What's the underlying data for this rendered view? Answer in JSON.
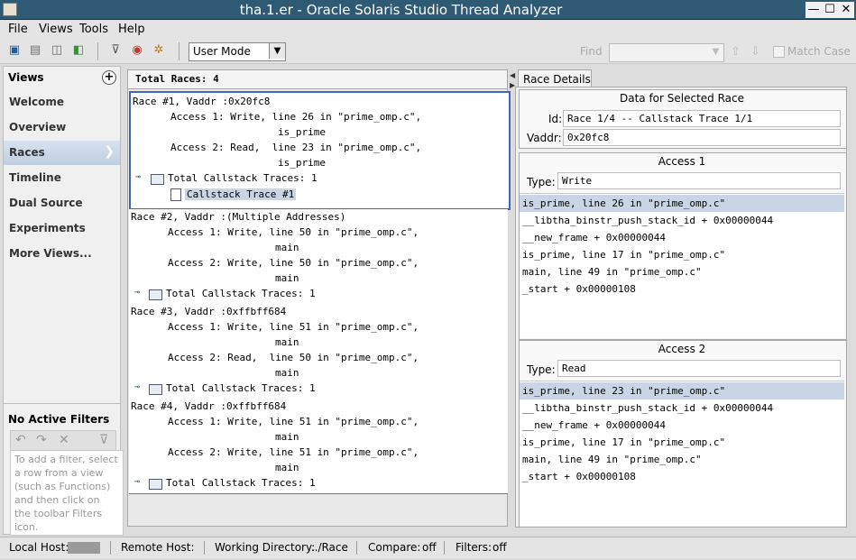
{
  "window": {
    "title": "tha.1.er  -  Oracle Solaris Studio Thread Analyzer",
    "min": "—",
    "max": "☐",
    "close": "✕"
  },
  "menu": [
    "File",
    "Views",
    "Tools",
    "Help"
  ],
  "toolbar": {
    "mode": "User Mode",
    "find_label": "Find",
    "match_case": "Match Case"
  },
  "views": {
    "title": "Views",
    "add": "+",
    "items": [
      "Welcome",
      "Overview",
      "Races",
      "Timeline",
      "Dual Source",
      "Experiments",
      "More Views..."
    ],
    "selected_chevron": "❯"
  },
  "filters": {
    "title": "No Active Filters",
    "help": "To add a filter, select a row from a view (such as Functions) and then click on the toolbar Filters icon."
  },
  "races": {
    "header": "Total Races: 4",
    "list": [
      {
        "title": "Race #1, Vaddr :0x20fc8",
        "a1": "Access 1: Write, line 26 in \"prime_omp.c\",",
        "a1f": "is_prime",
        "a2": "Access 2: Read,  line 23 in \"prime_omp.c\",",
        "a2f": "is_prime",
        "traces": "Total Callstack Traces: 1",
        "trace1": "Callstack Trace #1"
      },
      {
        "title": "Race #2, Vaddr :(Multiple Addresses)",
        "a1": "Access 1: Write, line 50 in \"prime_omp.c\",",
        "a1f": "main",
        "a2": "Access 2: Write, line 50 in \"prime_omp.c\",",
        "a2f": "main",
        "traces": "Total Callstack Traces: 1"
      },
      {
        "title": "Race #3, Vaddr :0xffbff684",
        "a1": "Access 1: Write, line 51 in \"prime_omp.c\",",
        "a1f": "main",
        "a2": "Access 2: Read,  line 50 in \"prime_omp.c\",",
        "a2f": "main",
        "traces": "Total Callstack Traces: 1"
      },
      {
        "title": "Race #4, Vaddr :0xffbff684",
        "a1": "Access 1: Write, line 51 in \"prime_omp.c\",",
        "a1f": "main",
        "a2": "Access 2: Write, line 51 in \"prime_omp.c\",",
        "a2f": "main",
        "traces": "Total Callstack Traces: 1"
      }
    ]
  },
  "details": {
    "tab": "Race Details",
    "section_title": "Data for Selected Race",
    "id_label": "Id:",
    "id_value": "Race 1/4 -- Callstack Trace 1/1",
    "vaddr_label": "Vaddr:",
    "vaddr_value": "0x20fc8",
    "access1": {
      "title": "Access 1",
      "type_label": "Type:",
      "type_value": "Write",
      "frames": [
        "is_prime, line 26 in \"prime_omp.c\"",
        "__libtha_binstr_push_stack_id + 0x00000044",
        "__new_frame + 0x00000044",
        "is_prime, line 17 in \"prime_omp.c\"",
        "main, line 49 in \"prime_omp.c\"",
        "_start + 0x00000108"
      ]
    },
    "access2": {
      "title": "Access 2",
      "type_label": "Type:",
      "type_value": "Read",
      "frames": [
        "is_prime, line 23 in \"prime_omp.c\"",
        "__libtha_binstr_push_stack_id + 0x00000044",
        "__new_frame + 0x00000044",
        "is_prime, line 17 in \"prime_omp.c\"",
        "main, line 49 in \"prime_omp.c\"",
        "_start + 0x00000108"
      ]
    }
  },
  "status": {
    "local_host": "Local Host:",
    "remote_host": "Remote Host:",
    "workdir_label": "Working Directory:",
    "workdir_value": ".../Race",
    "compare_label": "Compare:",
    "compare_value": "off",
    "filters_label": "Filters:",
    "filters_value": "off"
  }
}
